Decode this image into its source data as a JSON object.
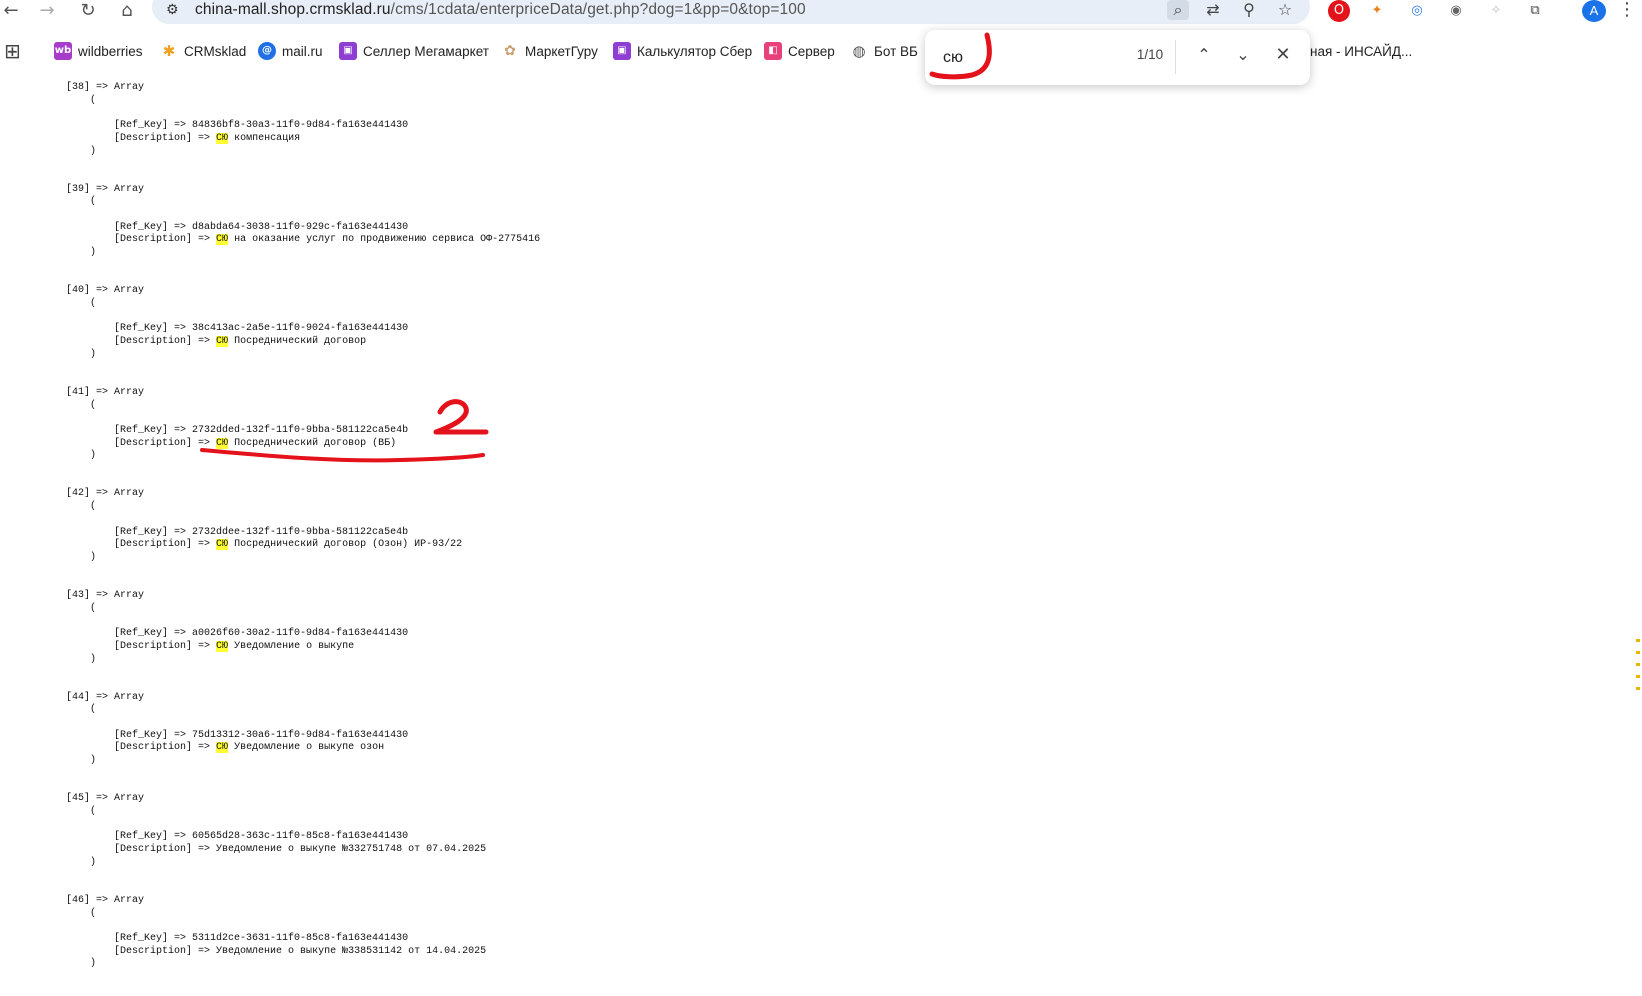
{
  "browser": {
    "nav": {
      "back_icon": "arrow-left-icon",
      "forward_icon": "arrow-right-icon",
      "reload_icon": "reload-icon",
      "home_icon": "home-icon"
    },
    "url_host": "china-mall.shop.crmsklad.ru",
    "url_path": "/cms/1cdata/enterpriceData/get.php?dog=1&pp=0&top=100",
    "profile_initial": "A"
  },
  "bookmarks": [
    {
      "label": "wildberries",
      "icon_text": "wb",
      "color": "#a63cc9"
    },
    {
      "label": "CRMsklad",
      "icon_text": "✱",
      "color": "#f0a020"
    },
    {
      "label": "mail.ru",
      "icon_text": "@",
      "color": "#1f6fe5"
    },
    {
      "label": "Селлер Мегамаркет",
      "icon_text": "▣",
      "color": "#8e3fd1"
    },
    {
      "label": "МаркетГуру",
      "icon_text": "✿",
      "color": "#c9a070"
    },
    {
      "label": "Калькулятор Сбер",
      "icon_text": "▣",
      "color": "#8e3fd1"
    },
    {
      "label": "Сервер",
      "icon_text": "◧",
      "color": "#e8407a"
    },
    {
      "label": "Бот ВБ",
      "icon_text": "◍",
      "color": "#555555"
    }
  ],
  "bookmark_tail": "ная - ИНСАЙД...",
  "find": {
    "query": "сю",
    "count": "1/10"
  },
  "entries": [
    {
      "index": "[38]",
      "ref_key": "84836bf8-30a3-11f0-9d84-fa163e441430",
      "highlight": "СЮ",
      "desc": " компенсация"
    },
    {
      "index": "[39]",
      "ref_key": "d8abda64-3038-11f0-929c-fa163e441430",
      "highlight": "СЮ",
      "desc": " на оказание услуг по продвижению сервиса ОФ-2775416"
    },
    {
      "index": "[40]",
      "ref_key": "38c413ac-2a5e-11f0-9024-fa163e441430",
      "highlight": "СЮ",
      "desc": " Посреднический договор"
    },
    {
      "index": "[41]",
      "ref_key": "2732dded-132f-11f0-9bba-581122ca5e4b",
      "highlight": "СЮ",
      "desc": " Посреднический договор (ВБ)"
    },
    {
      "index": "[42]",
      "ref_key": "2732ddee-132f-11f0-9bba-581122ca5e4b",
      "highlight": "СЮ",
      "desc": " Посреднический договор (Озон) ИР-93/22"
    },
    {
      "index": "[43]",
      "ref_key": "a0026f60-30a2-11f0-9d84-fa163e441430",
      "highlight": "СЮ",
      "desc": " Уведомление о выкупе"
    },
    {
      "index": "[44]",
      "ref_key": "75d13312-30a6-11f0-9d84-fa163e441430",
      "highlight": "СЮ",
      "desc": " Уведомление о выкупе озон"
    },
    {
      "index": "[45]",
      "ref_key": "60565d28-363c-11f0-85c8-fa163e441430",
      "highlight": "",
      "desc": "Уведомление о выкупе №332751748 от 07.04.2025"
    },
    {
      "index": "[46]",
      "ref_key": "5311d2ce-3631-11f0-85c8-fa163e441430",
      "highlight": "",
      "desc": "Уведомление о выкупе №338531142 от 14.04.2025"
    }
  ],
  "labels": {
    "array": "=> Array",
    "open": "(",
    "close": ")",
    "ref_key_prefix": "[Ref_Key] => ",
    "desc_prefix": "[Description] => "
  },
  "annotation": {
    "mark": "2",
    "color": "#e3121b"
  }
}
